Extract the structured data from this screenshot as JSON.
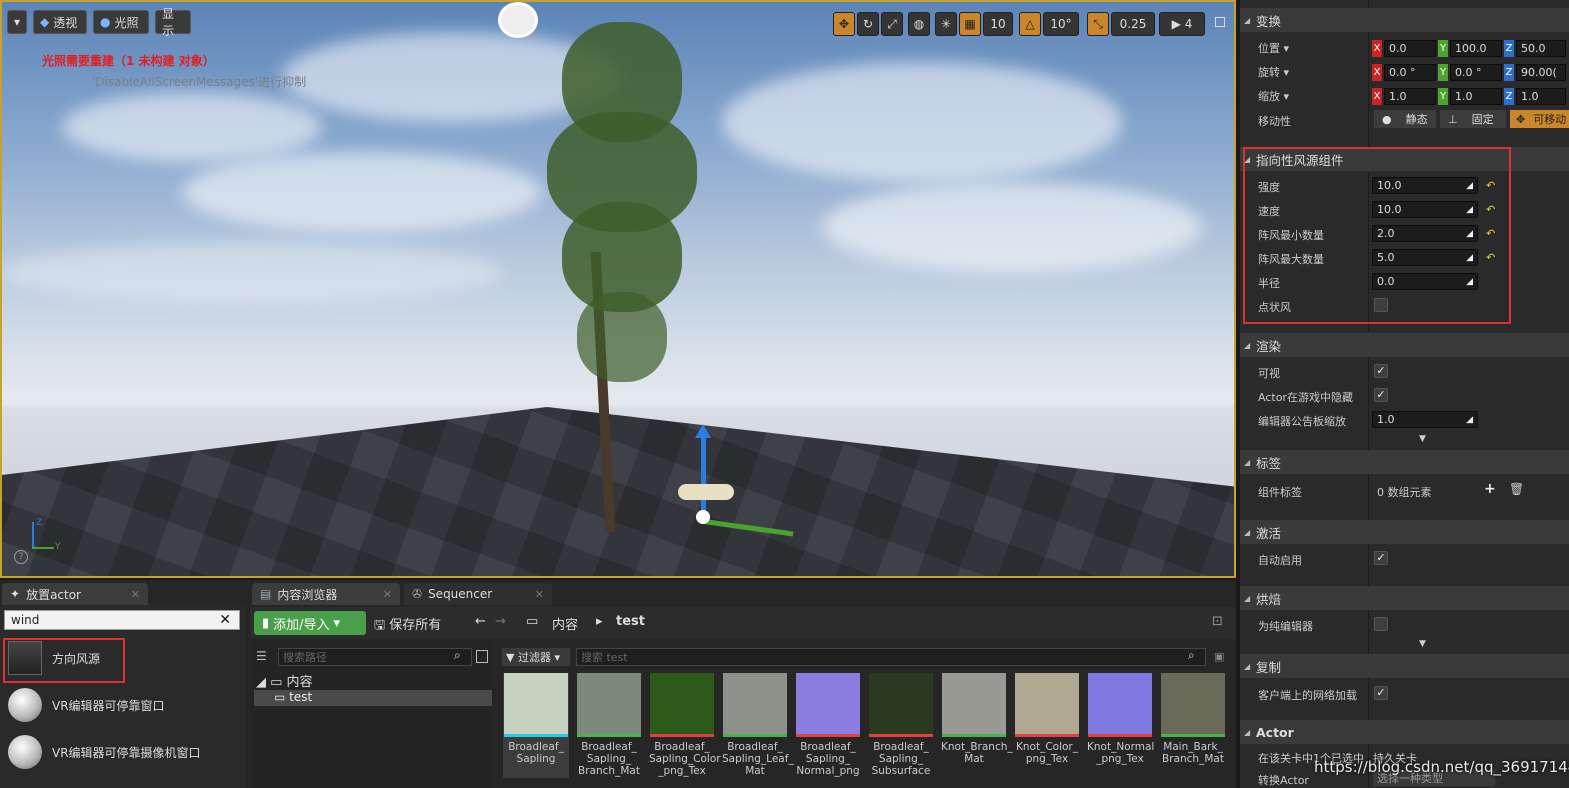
{
  "viewport": {
    "mode_menu": "▾",
    "perspective_btn": "透视",
    "lighting_btn": "光照",
    "show_btn": "显示",
    "warning_text": "光照需要重建（1 未构建 对象）",
    "suppress_text": "'DisableAllScreenMessages'进行抑制",
    "grid_snap": "10",
    "rotation_snap": "10°",
    "scale_snap": "0.25",
    "camera_speed": "4",
    "axis_z": "Z",
    "axis_y": "Y"
  },
  "place_actor": {
    "tab_label": "放置actor",
    "search_value": "wind",
    "items": [
      {
        "label": "方向风源"
      },
      {
        "label": "VR编辑器可停靠窗口"
      },
      {
        "label": "VR编辑器可停靠摄像机窗口"
      }
    ]
  },
  "content_browser": {
    "tab_label": "内容浏览器",
    "sequencer_tab": "Sequencer",
    "add_import": "添加/导入",
    "save_all": "保存所有",
    "breadcrumb_root": "内容",
    "breadcrumb_current": "test",
    "path_search_placeholder": "搜索路径",
    "filter_label": "过滤器",
    "asset_search_placeholder": "搜索 test",
    "tree_root": "内容",
    "tree_child": "test",
    "assets": [
      {
        "name": "Broadleaf_ Sapling",
        "color": "#22d0e0"
      },
      {
        "name": "Broadleaf_ Sapling_ Branch_Mat",
        "color": "#4caf50"
      },
      {
        "name": "Broadleaf_ Sapling_Color _png_Tex",
        "color": "#e04040"
      },
      {
        "name": "Broadleaf_ Sapling_Leaf_ Mat",
        "color": "#4caf50"
      },
      {
        "name": "Broadleaf_ Sapling_ Normal_png",
        "color": "#e04040"
      },
      {
        "name": "Broadleaf_ Sapling_ Subsurface",
        "color": "#e04040"
      },
      {
        "name": "Knot_Branch_ Mat",
        "color": "#4caf50"
      },
      {
        "name": "Knot_Color_ png_Tex",
        "color": "#e04040"
      },
      {
        "name": "Knot_Normal _png_Tex",
        "color": "#e04040"
      },
      {
        "name": "Main_Bark_ Branch_Mat",
        "color": "#4caf50"
      }
    ]
  },
  "details": {
    "transform": {
      "title": "变换",
      "location_label": "位置 ▾",
      "rotation_label": "旋转 ▾",
      "scale_label": "缩放 ▾",
      "mobility_label": "移动性",
      "location": {
        "x": "0.0",
        "y": "100.0",
        "z": "50.0"
      },
      "rotation": {
        "x": "0.0 °",
        "y": "0.0 °",
        "z": "90.00("
      },
      "scale": {
        "x": "1.0",
        "y": "1.0",
        "z": "1.0"
      },
      "mobility_static": "静态",
      "mobility_stationary": "固定",
      "mobility_movable": "可移动"
    },
    "wind": {
      "title": "指向性风源组件",
      "strength_label": "强度",
      "strength": "10.0",
      "speed_label": "速度",
      "speed": "10.0",
      "min_gust_label": "阵风最小数量",
      "min_gust": "2.0",
      "max_gust_label": "阵风最大数量",
      "max_gust": "5.0",
      "radius_label": "半径",
      "radius": "0.0",
      "point_wind_label": "点状风"
    },
    "rendering": {
      "title": "渲染",
      "visible_label": "可视",
      "hidden_in_game_label": "Actor在游戏中隐藏",
      "billboard_scale_label": "编辑器公告板缩放",
      "billboard_scale": "1.0"
    },
    "tags": {
      "title": "标签",
      "component_tags_label": "组件标签",
      "component_tags_value": "0 数组元素"
    },
    "activation": {
      "title": "激活",
      "auto_activate_label": "自动启用"
    },
    "cooking": {
      "title": "烘焙",
      "editor_only_label": "为纯编辑器"
    },
    "replication": {
      "title": "复制",
      "net_load_label": "客户端上的网络加载"
    },
    "actor": {
      "title": "Actor",
      "selected_label": "在该关卡中1个已选中",
      "selected_value": "持久关卡",
      "convert_label": "转换Actor",
      "convert_value": "选择一种类型"
    }
  },
  "watermark": "https://blog.csdn.net/qq_36917144"
}
